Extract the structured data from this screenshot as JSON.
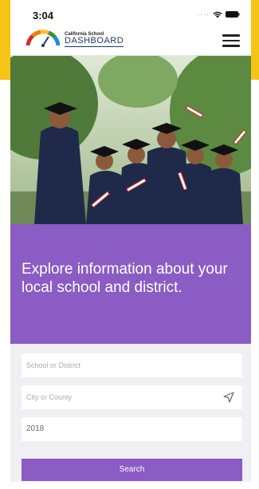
{
  "status_bar": {
    "time": "3:04"
  },
  "header": {
    "logo_small": "California School",
    "logo_big": "DASHBOARD"
  },
  "banner": {
    "headline": "Explore information about your local school and district."
  },
  "form": {
    "school_placeholder": "School or District",
    "city_placeholder": "City or County",
    "year_value": "2018",
    "search_label": "Search"
  },
  "colors": {
    "brand_purple": "#8b5cc4",
    "frame_yellow": "#f6c414",
    "logo_navy": "#1b3a6b"
  }
}
